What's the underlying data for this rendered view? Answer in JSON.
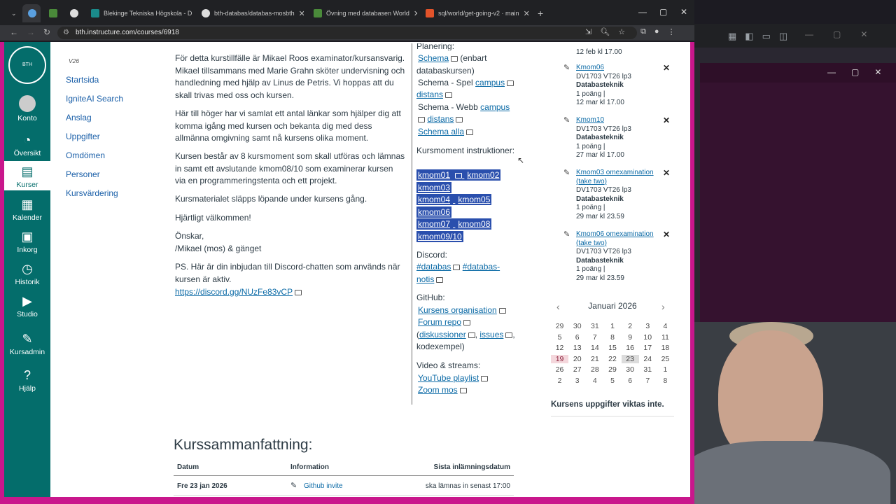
{
  "browser": {
    "tabs": [
      {
        "label": ""
      },
      {
        "label": ""
      },
      {
        "label": ""
      },
      {
        "label": "Blekinge Tekniska Högskola - D"
      },
      {
        "label": "bth-databas/databas-mosbth"
      },
      {
        "label": "Övning med databasen World"
      },
      {
        "label": "sql/world/get-going-v2 · main"
      }
    ],
    "url": "bth.instructure.com/courses/6918"
  },
  "global_nav": {
    "logo_text": "BTH",
    "items": [
      {
        "label": "Konto"
      },
      {
        "label": "Översikt"
      },
      {
        "label": "Kurser"
      },
      {
        "label": "Kalender"
      },
      {
        "label": "Inkorg"
      },
      {
        "label": "Historik"
      },
      {
        "label": "Studio"
      },
      {
        "label": "Kursadmin"
      },
      {
        "label": "Hjälp"
      }
    ]
  },
  "course_nav": {
    "term": "V26",
    "items": [
      {
        "label": "Startsida"
      },
      {
        "label": "IgniteAI Search"
      },
      {
        "label": "Anslag"
      },
      {
        "label": "Uppgifter"
      },
      {
        "label": "Omdömen"
      },
      {
        "label": "Personer"
      },
      {
        "label": "Kursvärdering"
      }
    ]
  },
  "content": {
    "p1": "För detta kurstillfälle är Mikael Roos examinator/kursansvarig. Mikael tillsammans med Marie Grahn sköter undervisning och handledning med hjälp av Linus de Petris. Vi hoppas att du skall trivas med oss och kursen.",
    "p2": "Här till höger har vi samlat ett antal länkar som hjälper dig att komma igång med kursen och bekanta dig med dess allmänna omgivning samt nå kursens olika moment.",
    "p3": "Kursen består av 8 kursmoment som skall utföras och lämnas in samt ett avslutande kmom08/10 som examinerar kursen via en programmeringstenta och ett projekt.",
    "p4": "Kursmaterialet släpps löpande under kursens gång.",
    "p5": "Hjärtligt välkommen!",
    "p6a": "Önskar,",
    "p6b": "/Mikael (mos) & gänget",
    "p7": "PS. Här är din inbjudan till Discord-chatten som används när kursen är aktiv.",
    "discord_link": "https://discord.gg/NUzFe83vCP"
  },
  "links_col": {
    "planering": "Planering:",
    "schema": "Schema",
    "schema_note": "(enbart databaskursen)",
    "spel": "Schema - Spel",
    "campus": "campus",
    "distans": "distans",
    "webb": "Schema - Webb",
    "schema_alla": "Schema alla",
    "kursmoment": "Kursmoment instruktioner:",
    "kmom": [
      "kmom01",
      "kmom02",
      "kmom03",
      "kmom04",
      "kmom05",
      "kmom06",
      "kmom07",
      "kmom08",
      "kmom09/10"
    ],
    "discord": "Discord:",
    "databas": "#databas",
    "databas_notis_a": "#databas-",
    "databas_notis_b": "notis",
    "github": "GitHub:",
    "org": "Kursens organisation",
    "forum": "Forum repo",
    "diskussioner": "diskussioner",
    "issues": "issues",
    "kodexempel": "kodexempel)",
    "video": "Video & streams:",
    "youtube": "YouTube playlist",
    "zoom": "Zoom mos"
  },
  "todo": {
    "top_partial": "12 feb kl 17.00",
    "items": [
      {
        "title": "Kmom06",
        "course": "DV1703 VT26 lp3",
        "name": "Databasteknik",
        "points": "1 poäng |",
        "due": "12 mar kl 17.00"
      },
      {
        "title": "Kmom10",
        "course": "DV1703 VT26 lp3",
        "name": "Databasteknik",
        "points": "1 poäng |",
        "due": "27 mar kl 17.00"
      },
      {
        "title": "Kmom03 omexamination (take two)",
        "course": "DV1703 VT26 lp3",
        "name": "Databasteknik",
        "points": "1 poäng |",
        "due": "29 mar kl 23.59"
      },
      {
        "title": "Kmom06 omexamination (take two)",
        "course": "DV1703 VT26 lp3",
        "name": "Databasteknik",
        "points": "1 poäng |",
        "due": "29 mar kl 23.59"
      }
    ]
  },
  "calendar": {
    "month": "Januari 2026",
    "days": [
      "29",
      "30",
      "31",
      "1",
      "2",
      "3",
      "4",
      "5",
      "6",
      "7",
      "8",
      "9",
      "10",
      "11",
      "12",
      "13",
      "14",
      "15",
      "16",
      "17",
      "18",
      "19",
      "20",
      "21",
      "22",
      "23",
      "24",
      "25",
      "26",
      "27",
      "28",
      "29",
      "30",
      "31",
      "1",
      "2",
      "3",
      "4",
      "5",
      "6",
      "7",
      "8"
    ],
    "today": "19",
    "selected": "23"
  },
  "weight_note": "Kursens uppgifter viktas inte.",
  "summary": {
    "title": "Kurssammanfattning:",
    "col_date": "Datum",
    "col_info": "Information",
    "col_due": "Sista inlämningsdatum",
    "row_date": "Fre 23 jan 2026",
    "row_info": "Github invite",
    "row_due": "ska lämnas in senast 17:00"
  }
}
